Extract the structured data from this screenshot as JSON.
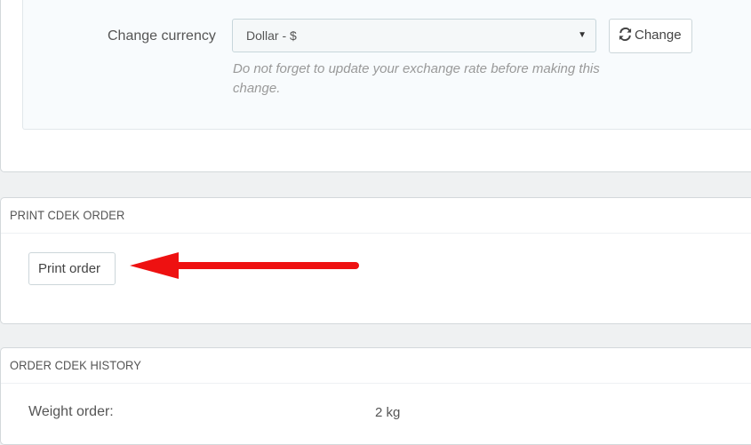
{
  "currency": {
    "label": "Change currency",
    "selected": "Dollar - $",
    "hint": "Do not forget to update your exchange rate before making this change.",
    "change_button": "Change"
  },
  "print_panel": {
    "title": "PRINT CDEK ORDER",
    "print_button": "Print order"
  },
  "history_panel": {
    "title": "ORDER CDEK HISTORY",
    "rows": [
      {
        "label": "Weight order:",
        "value": "2 kg"
      }
    ]
  },
  "colors": {
    "arrow": "#ee1111",
    "page_bg": "#eff1f2"
  },
  "icons": {
    "change": "refresh-icon",
    "select": "caret-down-icon"
  }
}
